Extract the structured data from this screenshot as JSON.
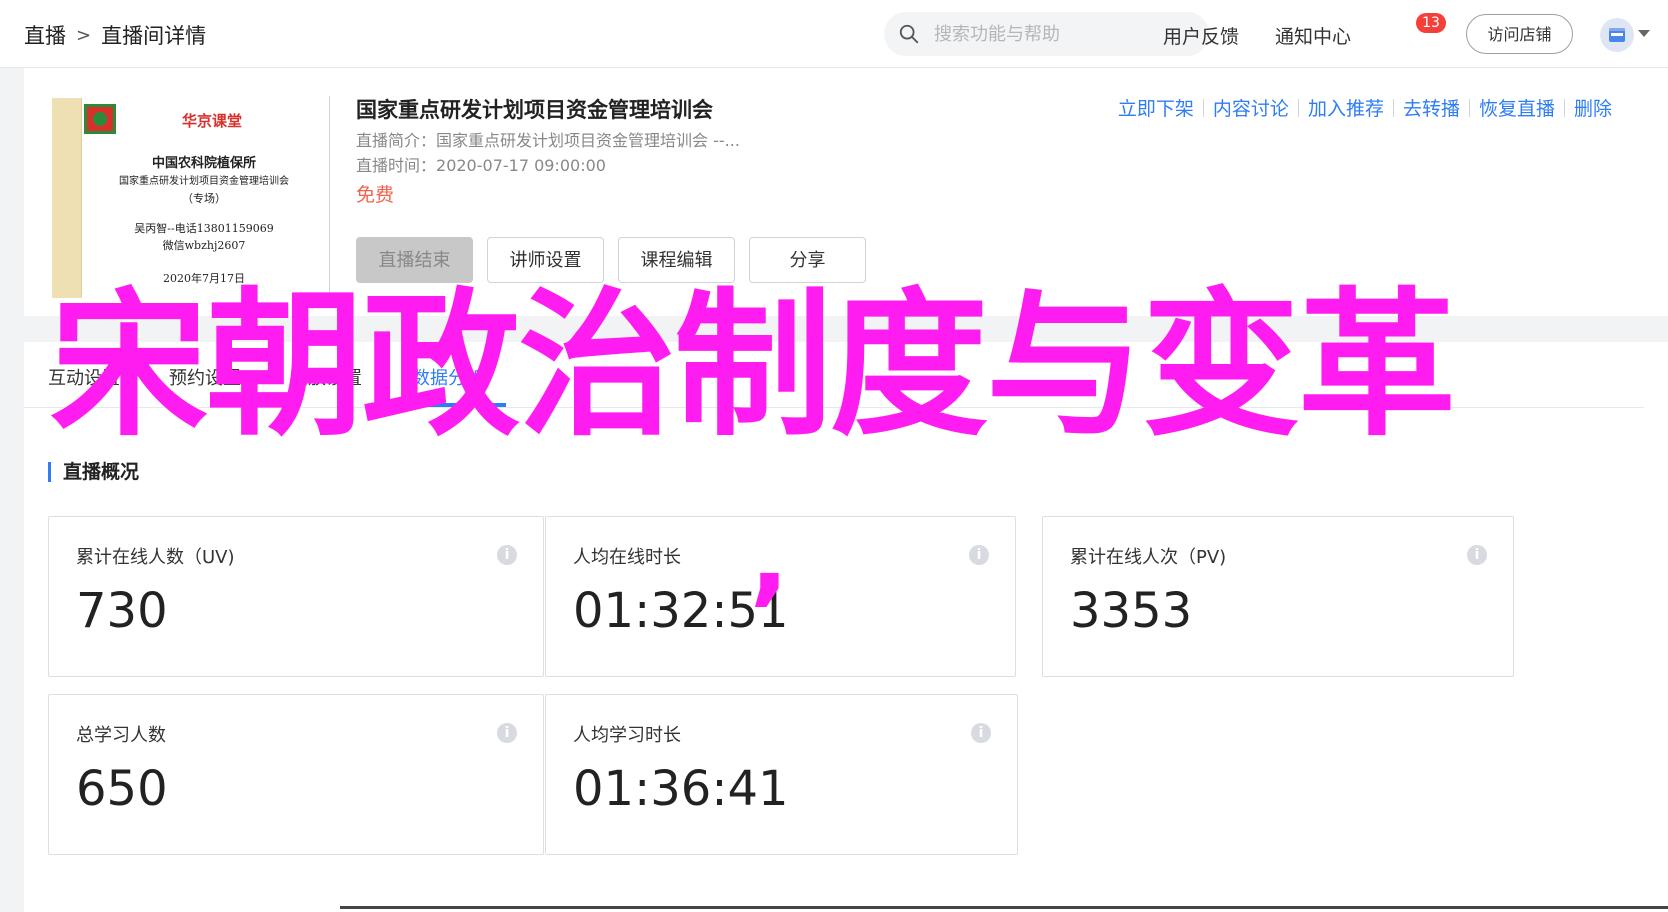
{
  "header": {
    "breadcrumb": [
      "直播",
      "直播间详情"
    ],
    "breadcrumb_sep": ">",
    "search_placeholder": "搜索功能与帮助",
    "feedback": "用户反馈",
    "notifications": "通知中心",
    "notification_count": "13",
    "visit_store": "访问店铺"
  },
  "course": {
    "title": "国家重点研发计划项目资金管理培训会",
    "intro_label": "直播简介：",
    "intro": "国家重点研发计划项目资金管理培训会 --...",
    "time_label": "直播时间：",
    "time": "2020-07-17 09:00:00",
    "price": "免费",
    "cover": {
      "brand": "华京课堂",
      "org": "中国农科院植保所",
      "line1": "国家重点研发计划项目资金管理培训会",
      "line2": "（专场）",
      "contact": "吴丙智--电话13801159069",
      "wechat": "微信wbzhj2607",
      "date": "2020年7月17日"
    },
    "actions": [
      "立即下架",
      "内容讨论",
      "加入推荐",
      "去转播",
      "恢复直播",
      "删除"
    ],
    "buttons": [
      "直播结束",
      "讲师设置",
      "课程编辑",
      "分享"
    ]
  },
  "tabs": [
    "互动设置",
    "预约设置",
    "回放设置",
    "数据分析"
  ],
  "active_tab": 3,
  "overlay": {
    "text": "宋朝政治制度与变革",
    "comma": "’",
    "color": "#ff1cf0"
  },
  "overview": {
    "title": "直播概况",
    "stats": [
      {
        "label": "累计在线人数（UV)",
        "value": "730"
      },
      {
        "label": "人均在线时长",
        "value": "01:32:51"
      },
      {
        "label": "累计在线人次（PV)",
        "value": "3353"
      },
      {
        "label": "总学习人数",
        "value": "650"
      },
      {
        "label": "人均学习时长",
        "value": "01:36:41"
      }
    ]
  },
  "colors": {
    "accent": "#2f7df6",
    "price": "#f06450",
    "badge": "#f5403a"
  }
}
